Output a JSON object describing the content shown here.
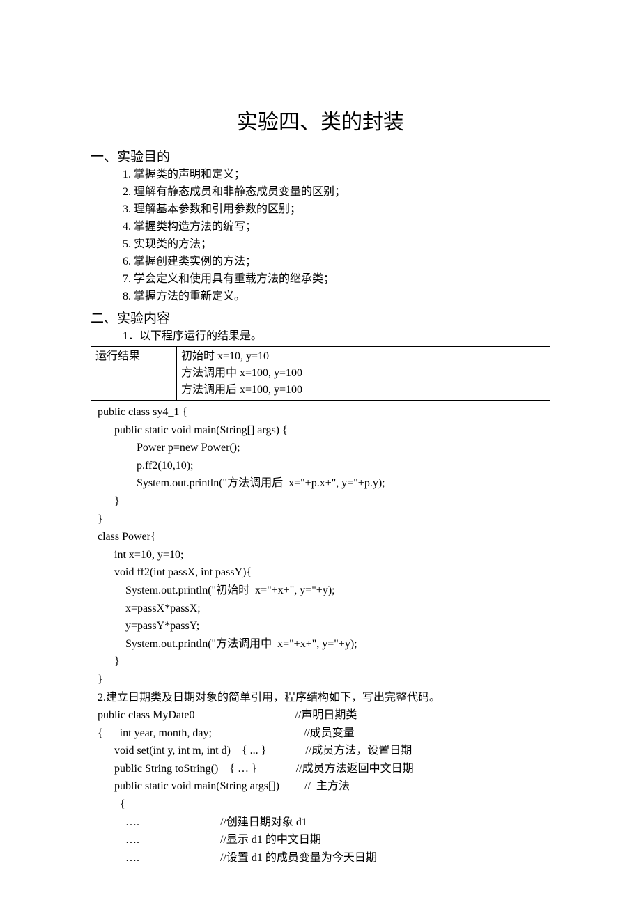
{
  "title": "实验四、类的封装",
  "section1": {
    "heading": "一、实验目的",
    "items": [
      "1. 掌握类的声明和定义；",
      "2. 理解有静态成员和非静态成员变量的区别；",
      "3. 理解基本参数和引用参数的区别；",
      "4. 掌握类构造方法的编写；",
      "5. 实现类的方法；",
      "6. 掌握创建类实例的方法；",
      "7. 学会定义和使用具有重载方法的继承类；",
      "8. 掌握方法的重新定义。"
    ]
  },
  "section2": {
    "heading": "二、实验内容",
    "item1": "1．以下程序运行的结果是。",
    "result_label": "运行结果",
    "result_lines": {
      "l1": "初始时 x=10, y=10",
      "l2": "方法调用中 x=100, y=100",
      "l3": "方法调用后 x=100, y=100"
    },
    "code1": {
      "l1": "public class sy4_1 {",
      "l2": "      public static void main(String[] args) {",
      "l3": "              Power p=new Power();",
      "l4": "              p.ff2(10,10);",
      "l5a": "              System.out.println(\"",
      "l5b": "方法调用后",
      "l5c": "  x=\"+p.x+\", y=\"+p.y);",
      "l6": "      }",
      "l7": "}",
      "l8": "class Power{",
      "l9": "      int x=10, y=10;",
      "l10": "      void ff2(int passX, int passY){",
      "l11a": "          System.out.println(\"",
      "l11b": "初始时",
      "l11c": "  x=\"+x+\", y=\"+y);",
      "l12": "          x=passX*passX;",
      "l13": "          y=passY*passY;",
      "l14a": "          System.out.println(\"",
      "l14b": "方法调用中",
      "l14c": "  x=\"+x+\", y=\"+y);",
      "l15": "      }",
      "l16": "}"
    },
    "item2": "2.建立日期类及日期对象的简单引用，程序结构如下，写出完整代码。",
    "code2": {
      "l1a": "public class MyDate0                                    //",
      "l1b": "声明日期类",
      "l2a": "{      int year, month, day;                                 //",
      "l2b": "成员变量",
      "l3a": "      void set(int y, int m, int d)    { ... }              //",
      "l3b": "成员方法，设置日期",
      "l4a": "      public String toString()    { … }              //",
      "l4b": "成员方法返回中文日期",
      "l5a": "      public static void main(String args[])         //  ",
      "l5b": "主方法",
      "l6": "        {",
      "l7a": "          ….                             //",
      "l7b": "创建日期对象",
      "l7c": " d1",
      "l8a": "          ….                             //",
      "l8b": "显示",
      "l8c": " d1 ",
      "l8d": "的中文日期",
      "l9a": "          ….                             //",
      "l9b": "设置",
      "l9c": " d1 ",
      "l9d": "的成员变量为今天日期"
    }
  }
}
